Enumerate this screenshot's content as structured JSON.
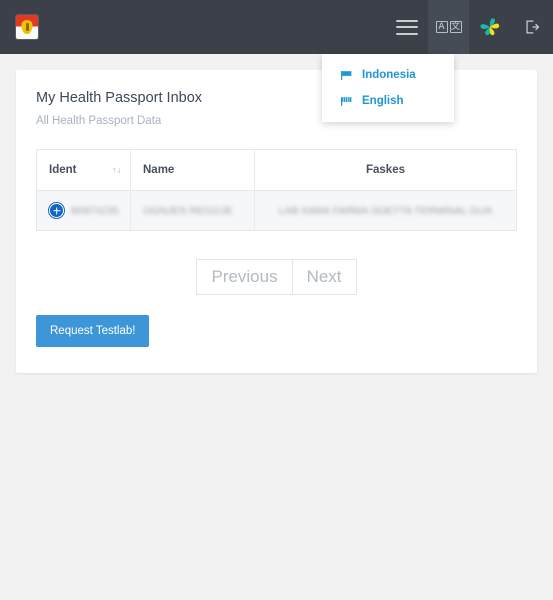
{
  "navbar": {
    "brand_name": "health-ministry-logo",
    "menu_toggle_label": "",
    "translate_label_a": "A",
    "translate_label_b": "文",
    "app_logo_label": "",
    "logout_label": ""
  },
  "language_menu": {
    "items": [
      {
        "label": "Indonesia",
        "icon": "flag-icon"
      },
      {
        "label": "English",
        "icon": "flag-icon"
      }
    ]
  },
  "card": {
    "title": "My Health Passport Inbox",
    "subtitle": "All Health Passport Data"
  },
  "table": {
    "columns": [
      {
        "key": "ident",
        "label": "Ident",
        "sortable": true,
        "sort_glyph": "↑↓"
      },
      {
        "key": "name",
        "label": "Name",
        "sortable": false
      },
      {
        "key": "faskes",
        "label": "Faskes",
        "sortable": false
      }
    ],
    "rows": [
      {
        "expand_label": "+",
        "ident": "B0974235",
        "name": "OGNJEN REGOJE",
        "faskes": "LAB KIMIA FARMA SOETTA TERMINAL DUA"
      }
    ]
  },
  "pagination": {
    "previous_label": "Previous",
    "next_label": "Next"
  },
  "actions": {
    "request_testlab_label": "Request Testlab!"
  },
  "colors": {
    "navbar_bg": "#3b4049",
    "primary_button": "#3d96d8",
    "link_blue": "#2196d6",
    "page_bg": "#f2f2f2",
    "card_bg": "#ffffff",
    "row_bg": "#f6f7f8"
  }
}
